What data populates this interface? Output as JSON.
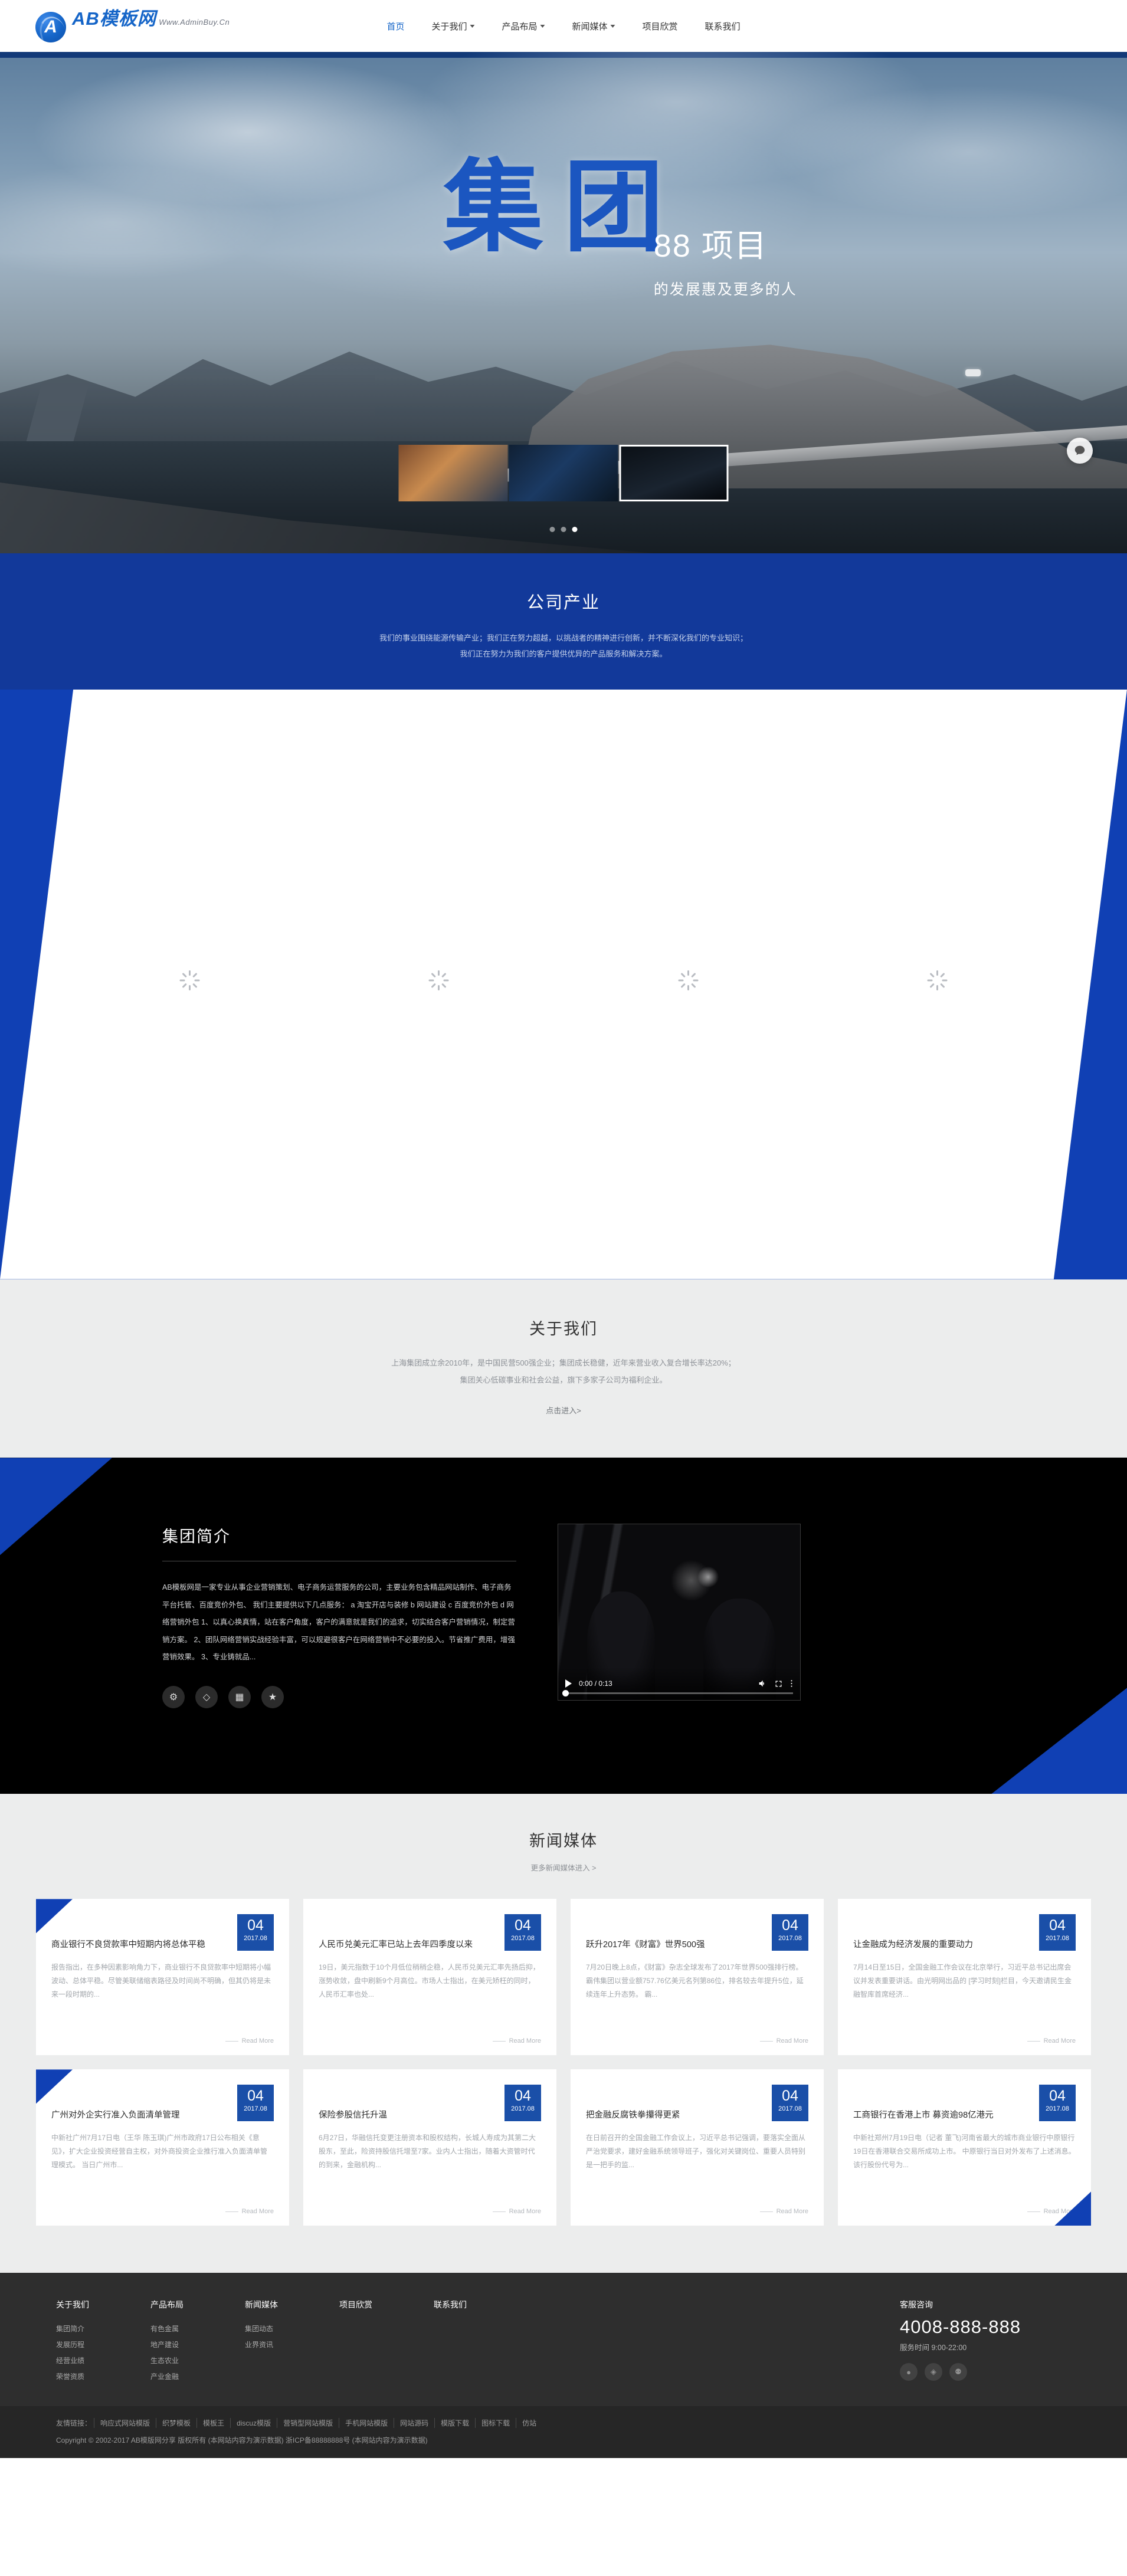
{
  "header": {
    "logo": {
      "title": "AB模板网",
      "subtitle": "Www.AdminBuy.Cn",
      "badge_letter": "A"
    },
    "nav": [
      {
        "label": "首页",
        "has_caret": false,
        "active": true
      },
      {
        "label": "关于我们",
        "has_caret": true,
        "active": false
      },
      {
        "label": "产品布局",
        "has_caret": true,
        "active": false
      },
      {
        "label": "新闻媒体",
        "has_caret": true,
        "active": false
      },
      {
        "label": "项目欣赏",
        "has_caret": false,
        "active": false
      },
      {
        "label": "联系我们",
        "has_caret": false,
        "active": false
      }
    ]
  },
  "hero": {
    "cn_title": "集团",
    "number_title": "88 项目",
    "subtitle": "的发展惠及更多的人",
    "thumbs": [
      "缩略图一",
      "缩略图二",
      "缩略图三"
    ]
  },
  "industry": {
    "title": "公司产业",
    "line1": "我们的事业围绕能源传输产业；我们正在努力超越，以挑战者的精神进行创新，并不断深化我们的专业知识；",
    "line2": "我们正在努力为我们的客户提供优异的产品服务和解决方案。"
  },
  "products": {
    "items": [
      {
        "label": ""
      },
      {
        "label": ""
      },
      {
        "label": ""
      },
      {
        "label": ""
      }
    ]
  },
  "about": {
    "title": "关于我们",
    "line1": "上海集团成立余2010年，是中国民营500强企业；集团成长稳健，近年来营业收入复合增长率达20%；",
    "line2": "集团关心低碳事业和社会公益，旗下多家子公司为福利企业。",
    "enter_label": "点击进入>"
  },
  "intro": {
    "title": "集团简介",
    "body": "AB模板网是一家专业从事企业营销策划、电子商务运营服务的公司，主要业务包含精品网站制作、电子商务平台托管、百度竞价外包、 我们主要提供以下几点服务： a 淘宝开店与装修 b 网站建设 c 百度竞价外包 d 网络营销外包 1、以真心换真情，站在客户角度，客户的满意就是我们的追求，切实结合客户营销情况，制定营销方案。 2、团队网络营销实战经验丰富，可以规避很客户在网络营销中不必要的投入。节省推广费用，增强营销效果。 3、专业铸就品...",
    "icons": [
      "gears-icon",
      "tag-icon",
      "bars-chart-icon",
      "star-icon"
    ],
    "video": {
      "current_time": "0:00",
      "duration": "0:13",
      "time_display": "0:00 / 0:13",
      "controls": [
        "play-icon",
        "volume-icon",
        "fullscreen-icon",
        "more-options-icon"
      ]
    }
  },
  "news": {
    "title": "新闻媒体",
    "more_label": "更多新闻媒体进入 >",
    "read_more_label": "Read More",
    "cards": [
      {
        "day": "04",
        "month": "2017.08",
        "title": "商业银行不良贷款率中短期内将总体平稳",
        "excerpt": "报告指出，在多种因素影响角力下，商业银行不良贷款率中短期将小幅波动、总体平稳。尽管美联储缩表路径及时间尚不明确，但其仍将是未来一段时期的..."
      },
      {
        "day": "04",
        "month": "2017.08",
        "title": "人民币兑美元汇率已站上去年四季度以来",
        "excerpt": "19日，美元指数于10个月低位稍稍企稳，人民币兑美元汇率先扬后抑，涨势收敛，盘中刷新9个月高位。市场人士指出，在美元矫枉的同时，人民币汇率也处..."
      },
      {
        "day": "04",
        "month": "2017.08",
        "title": "跃升2017年《财富》世界500强",
        "excerpt": "7月20日晚上8点，《财富》杂志全球发布了2017年世界500强排行榜。霸伟集团以营业额757.76亿美元名列第86位，排名较去年提升5位，延续连年上升态势。 霸..."
      },
      {
        "day": "04",
        "month": "2017.08",
        "title": "让金融成为经济发展的重要动力",
        "excerpt": "7月14日至15日，全国金融工作会议在北京举行，习近平总书记出席会议并发表重要讲话。由光明网出品的 [学习时刻]栏目，今天邀请民生金融智库首席经济..."
      },
      {
        "day": "04",
        "month": "2017.08",
        "title": "广州对外企实行准入负面清单管理",
        "excerpt": "中新社广州7月17日电（王华 陈玉琪)广州市政府17日公布相关《意见》，扩大企业投资经营自主权，对外商投资企业推行准入负面清单管理模式。 当日广州市..."
      },
      {
        "day": "04",
        "month": "2017.08",
        "title": "保险参股信托升温",
        "excerpt": "6月27日，华融信托变更注册资本和股权结构，长城人寿成为其第二大股东，至此，险资持股信托增至7家。业内人士指出，随着大资管时代的到来，金融机构..."
      },
      {
        "day": "04",
        "month": "2017.08",
        "title": "把金融反腐铁拳攥得更紧",
        "excerpt": "在日前召开的全国金融工作会议上，习近平总书记强调，要落实全面从严治党要求，建好金融系统领导班子，强化对关键岗位、重要人员特别是一把手的监..."
      },
      {
        "day": "04",
        "month": "2017.08",
        "title": "工商银行在香港上市 募资逾98亿港元",
        "excerpt": "中新社郑州7月19日电（记者 董飞)河南省最大的城市商业银行中原银行19日在香港联合交易所成功上市。 中原银行当日对外发布了上述消息。该行股份代号为..."
      }
    ]
  },
  "footer": {
    "columns": [
      {
        "title": "关于我们",
        "links": [
          "集团简介",
          "发展历程",
          "经营业绩",
          "荣誉资质"
        ]
      },
      {
        "title": "产品布局",
        "links": [
          "有色金属",
          "地产建设",
          "生态农业",
          "产业金融"
        ]
      },
      {
        "title": "新闻媒体",
        "links": [
          "集团动态",
          "业界资讯"
        ]
      },
      {
        "title": "项目欣赏",
        "links": []
      },
      {
        "title": "联系我们",
        "links": []
      }
    ],
    "contact": {
      "title": "客服咨询",
      "phone": "4008-888-888",
      "hours": "服务时间 9:00-22:00",
      "social": [
        "qq-icon",
        "weibo-icon",
        "wechat-icon"
      ]
    },
    "friend_links_label": "友情链接：",
    "friend_links": [
      "响应式网站模版",
      "织梦模板",
      "模板王",
      "discuz模版",
      "营销型网站模版",
      "手机网站模版",
      "网站源码",
      "模版下载",
      "图标下载",
      "仿站"
    ],
    "copyright": "Copyright © 2002-2017 AB模版网分享 版权所有 (本网站内容为演示数据)  浙ICP备88888888号  (本网站内容为演示数据)"
  },
  "colors": {
    "brand_blue": "#1040b4",
    "deep_blue": "#12399a",
    "date_blue": "#1a4fa8",
    "footer_dark": "#2e2e2e",
    "bottom_dark": "#262626",
    "section_gray": "#eceded"
  }
}
